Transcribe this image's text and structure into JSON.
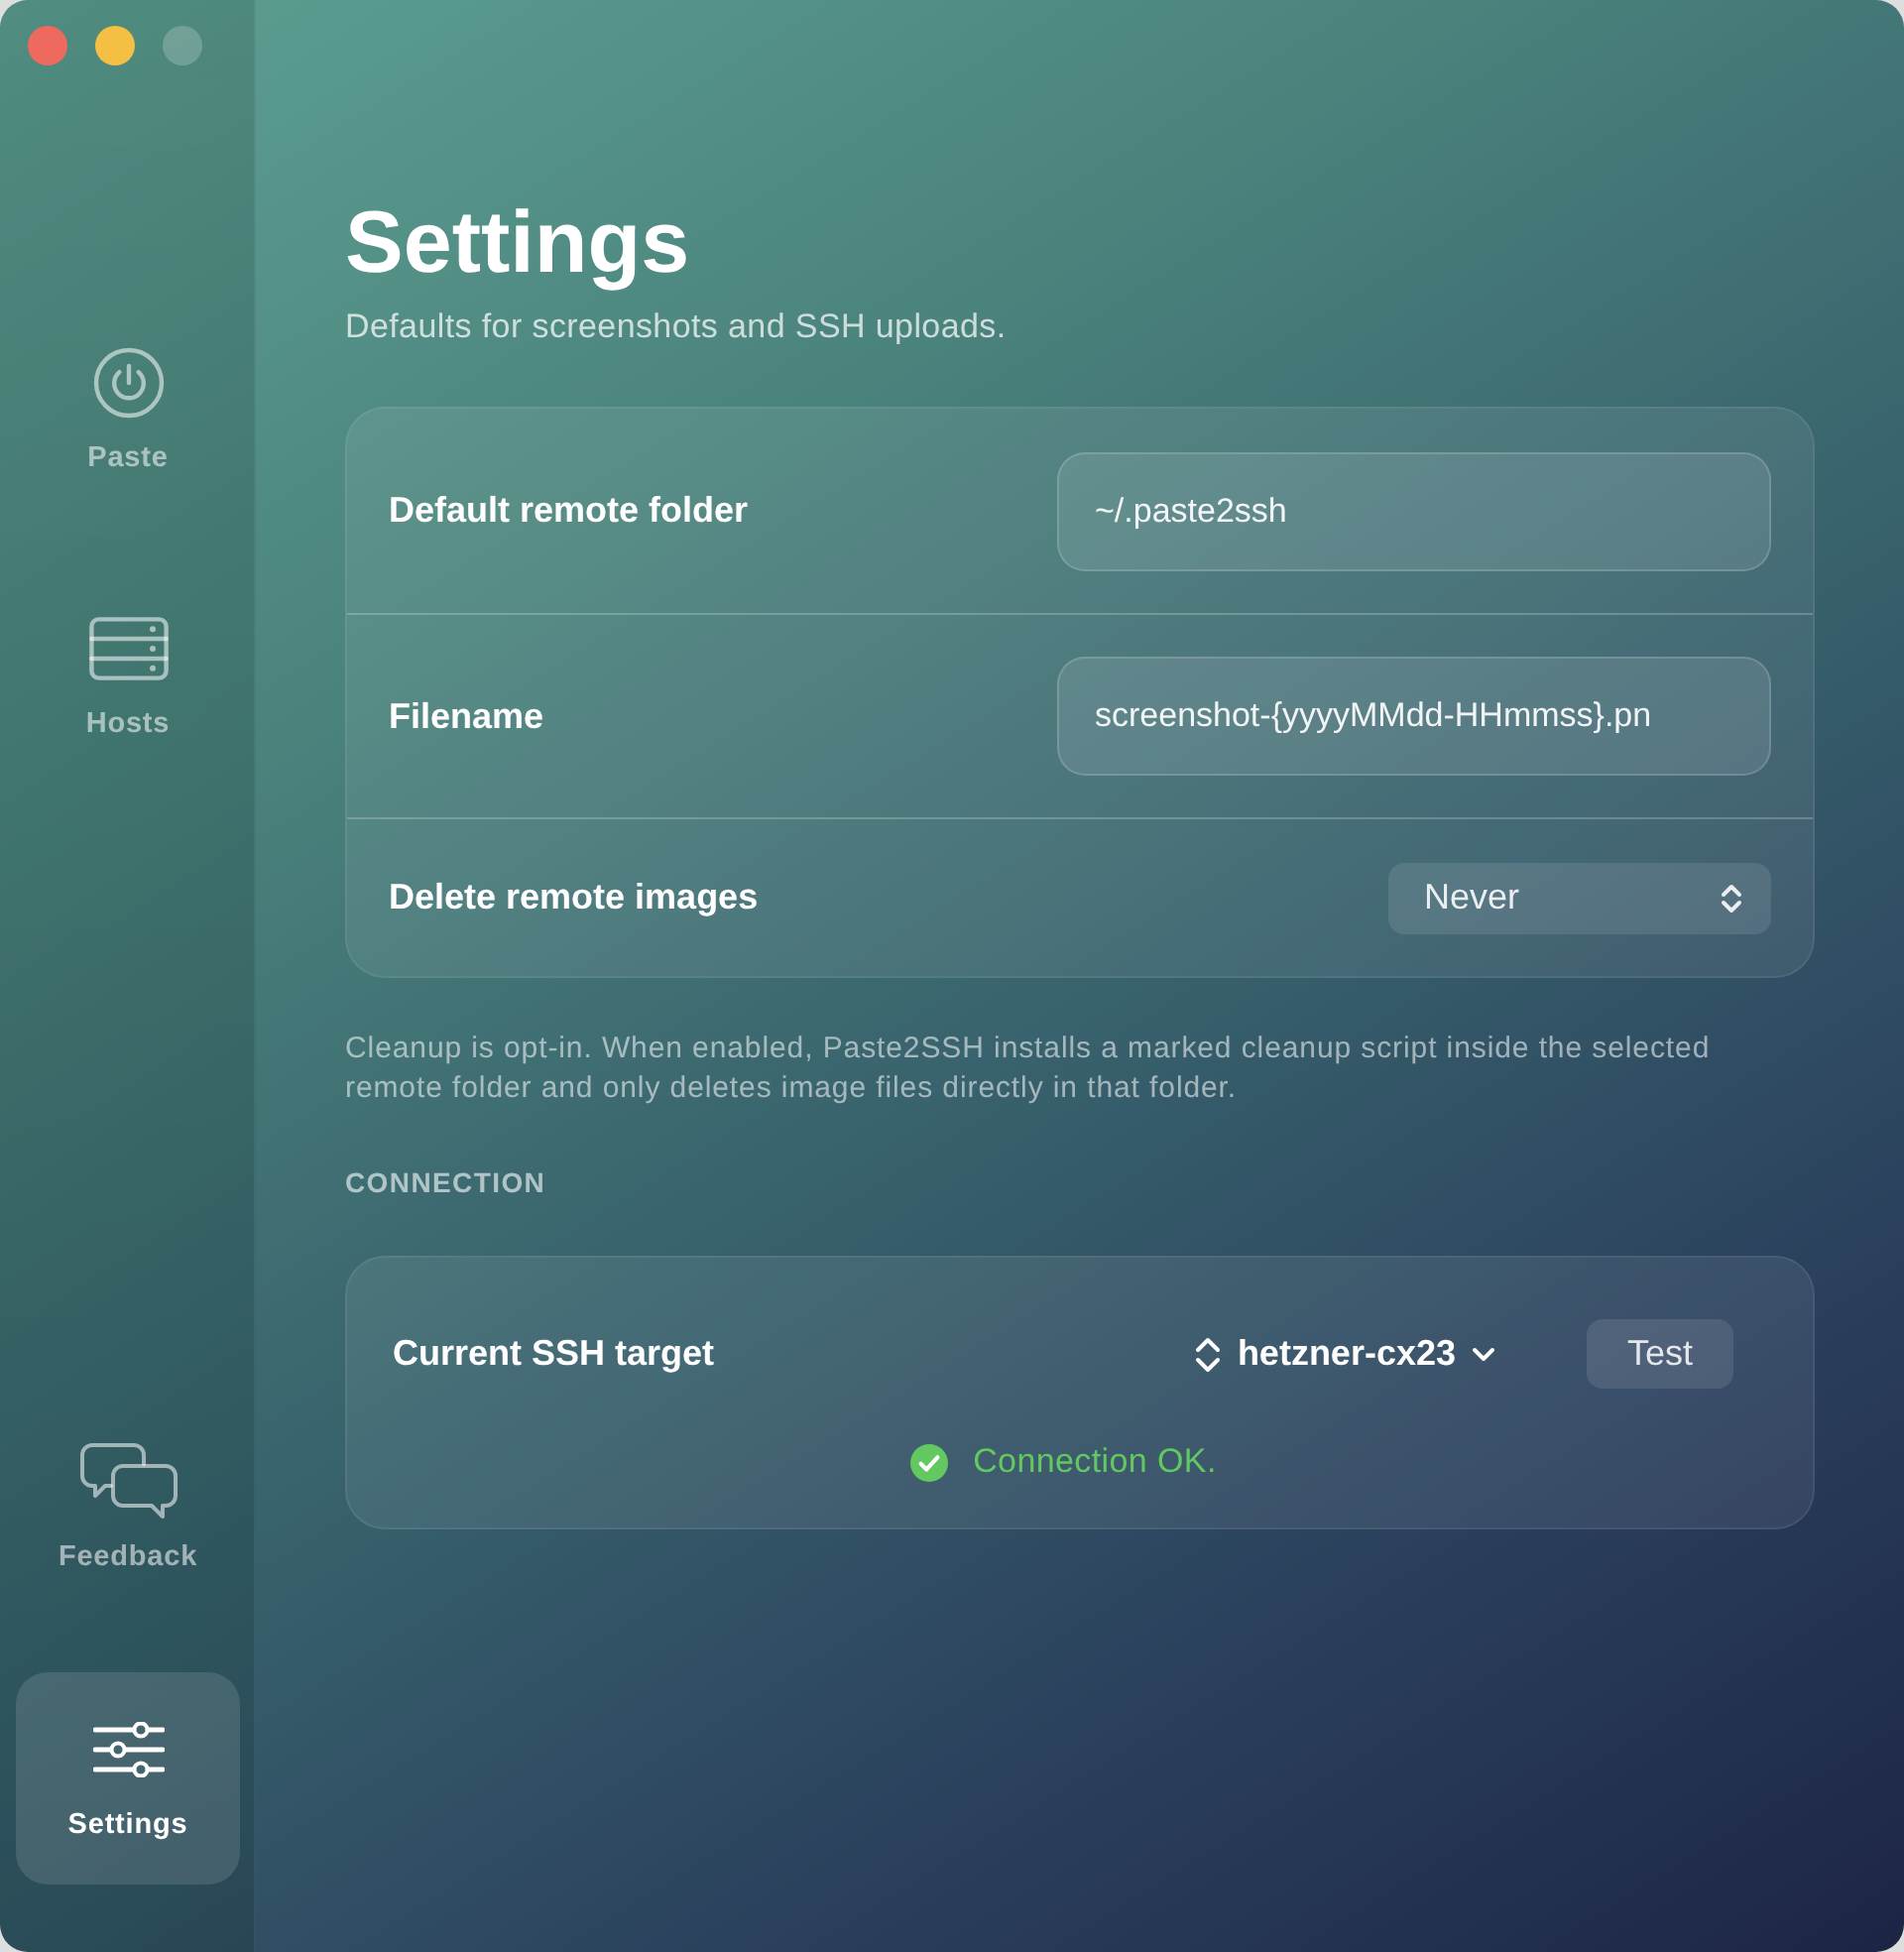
{
  "window_buttons": [
    {
      "kind": "close",
      "disabled": false
    },
    {
      "kind": "minimize",
      "disabled": false
    },
    {
      "kind": "zoom",
      "disabled": true
    }
  ],
  "sidebar": {
    "top_items": [
      {
        "label": "Paste",
        "selected": false
      },
      {
        "label": "Hosts",
        "selected": false
      }
    ],
    "bottom_items": [
      {
        "label": "Feedback",
        "selected": false
      },
      {
        "label": "Settings",
        "selected": true
      }
    ]
  },
  "header": {
    "title": "Settings",
    "subtitle": "Defaults for screenshots and SSH uploads."
  },
  "settings_card": {
    "rows": [
      {
        "kind": "text",
        "label": "Default remote folder",
        "value": "~/.paste2ssh"
      },
      {
        "kind": "text",
        "label": "Filename",
        "value": "screenshot-{yyyyMMdd-HHmmss}.pn"
      },
      {
        "kind": "select",
        "label": "Delete remote images",
        "value": "Never"
      }
    ]
  },
  "note": "Cleanup is opt-in. When enabled, Paste2SSH installs a marked cleanup script inside the selected remote folder and only deletes image files directly in that folder.",
  "connection": {
    "heading": "CONNECTION",
    "label": "Current SSH target",
    "host": "hetzner-cx23",
    "test_button": "Test",
    "status": {
      "ok": true,
      "text": "Connection OK."
    }
  }
}
